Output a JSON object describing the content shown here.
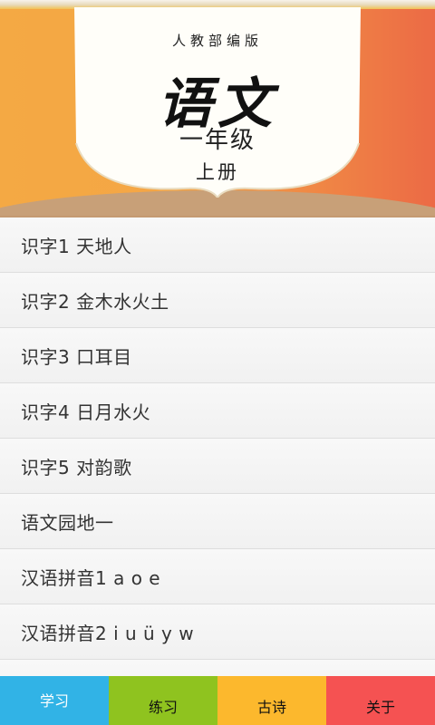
{
  "banner": {
    "publisher": "人教部编版",
    "subject": "语文",
    "grade": "一年级",
    "volume": "上册"
  },
  "lessons": [
    {
      "label": "识字1 天地人"
    },
    {
      "label": "识字2 金木水火土"
    },
    {
      "label": "识字3 口耳目"
    },
    {
      "label": "识字4 日月水火"
    },
    {
      "label": "识字5 对韵歌"
    },
    {
      "label": "语文园地一"
    },
    {
      "label": "汉语拼音1 a o e"
    },
    {
      "label": "汉语拼音2 i u ü y w"
    },
    {
      "label": ""
    }
  ],
  "tabs": [
    {
      "label": "学习",
      "color": "#31b3e6",
      "active": true
    },
    {
      "label": "练习",
      "color": "#8fc31f",
      "active": false
    },
    {
      "label": "古诗",
      "color": "#fcb82d",
      "active": false
    },
    {
      "label": "关于",
      "color": "#f55252",
      "active": false
    }
  ]
}
